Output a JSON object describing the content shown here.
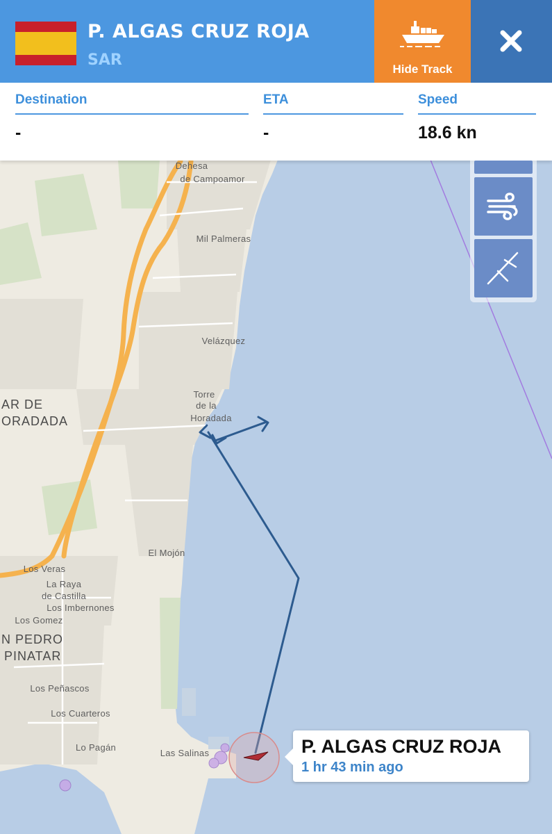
{
  "header": {
    "vessel_name": "P. ALGAS CRUZ ROJA",
    "vessel_type": "SAR",
    "flag": "spain-flag",
    "hide_track_label": "Hide Track",
    "colors": {
      "header_bg": "#4c97e0",
      "hide_track_bg": "#f0892e",
      "close_bg": "#3b74b6"
    }
  },
  "info": {
    "destination_label": "Destination",
    "destination_value": "-",
    "eta_label": "ETA",
    "eta_value": "-",
    "speed_label": "Speed",
    "speed_value": "18.6 kn"
  },
  "controls": [
    "wind-icon",
    "compass-ruler-icon"
  ],
  "map": {
    "places": {
      "dehesa": "Dehesa",
      "campoamor": "de Campoamor",
      "mil_palmeras": "Mil Palmeras",
      "velazquez": "Velázquez",
      "torre": "Torre",
      "de_la": "de la",
      "horadada": "Horadada",
      "ar_de": "AR DE",
      "oradada": "ORADADA",
      "el_mojon": "El Mojón",
      "los_veras": "Los Veras",
      "la_raya": "La Raya",
      "de_castilla": "de Castilla",
      "los_imbernones": "Los Imbernones",
      "los_gomez": "Los Gomez",
      "n_pedro": "N PEDRO",
      "pinatar": "PINATAR",
      "los_penascos": "Los Peñascos",
      "los_cuarteros": "Los Cuarteros",
      "lo_pagan": "Lo Pagán",
      "las_salinas": "Las Salinas"
    }
  },
  "vessel_label": {
    "name": "P. ALGAS CRUZ ROJA",
    "last_seen": "1 hr 43 min ago"
  }
}
